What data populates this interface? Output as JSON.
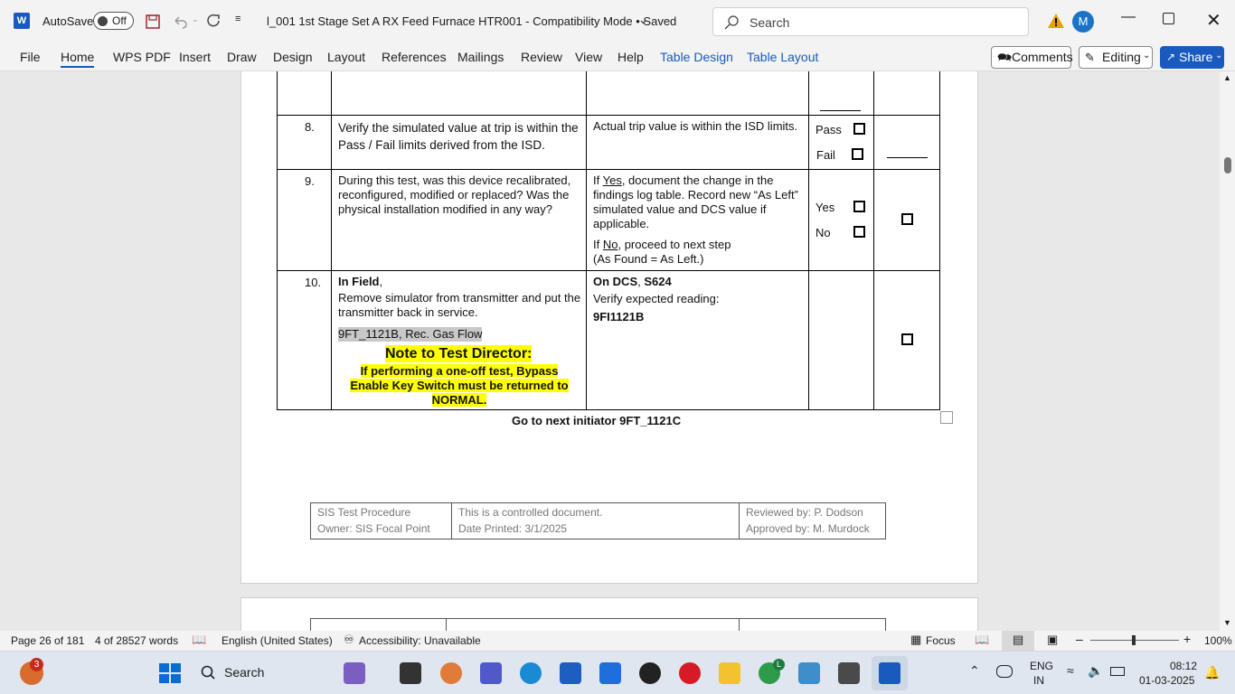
{
  "titlebar": {
    "autosave_label": "AutoSave",
    "autosave_state": "Off",
    "doc_title": "l_001 1st Stage Set A RX Feed Furnace HTR001  -  Compatibility Mode • Saved",
    "search_placeholder": "Search",
    "avatar_initial": "M"
  },
  "ribbon": {
    "tabs": [
      "File",
      "Home",
      "WPS PDF",
      "Insert",
      "Draw",
      "Design",
      "Layout",
      "References",
      "Mailings",
      "Review",
      "View",
      "Help",
      "Table Design",
      "Table Layout"
    ],
    "comments_label": "Comments",
    "editing_label": "Editing",
    "share_label": "Share"
  },
  "rows": [
    {
      "num": "8.",
      "left": "Verify the simulated value at trip is within the Pass / Fail limits derived from the ISD.",
      "right": "Actual trip value is within the ISD limits.",
      "opt1": "Pass",
      "opt2": "Fail"
    },
    {
      "num": "9.",
      "left": "During this test, was this device recalibrated, reconfigured, modified or replaced?  Was the physical installation modified in any way?",
      "right_pre": "If ",
      "right_yes": "Yes",
      "right_rest": ", document the change in the findings log table.  Record new “As Left” simulated value and DCS value if applicable.",
      "right2_pre": "If ",
      "right2_no": "No",
      "right2_rest": ", proceed to next step",
      "right3": "(As Found = As Left.)",
      "opt1": "Yes",
      "opt2": "No"
    },
    {
      "num": "10.",
      "left_bold": "In Field",
      "left_comma": ",",
      "left_text": "Remove simulator from transmitter and put the transmitter back in service.",
      "tag": "9FT_1121B, Rec. Gas Flow",
      "note_title": "Note to Test Director:",
      "note_body": "If performing a one-off test, Bypass Enable Key Switch must be returned to NORMAL.",
      "right_b1": "On DCS",
      "right_b2": ", ",
      "right_b3": "S624",
      "right_text": "Verify expected reading:",
      "right_tag": "9FI1121B"
    }
  ],
  "next_initiator": "Go to next initiator 9FT_1121C",
  "footer": {
    "c1_l1": "SIS Test Procedure",
    "c1_l2": "Owner: SIS Focal Point",
    "c2_l1": "This is a controlled document.",
    "c2_l2": "Date Printed: 3/1/2025",
    "c3_l1": "Reviewed by: P. Dodson",
    "c3_l2": "Approved by: M. Murdock"
  },
  "status": {
    "page": "Page 26 of 181",
    "words": "4 of 28527 words",
    "language": "English (United States)",
    "accessibility": "Accessibility: Unavailable",
    "focus": "Focus",
    "zoom": "100%"
  },
  "taskbar": {
    "search_label": "Search",
    "badge": "3",
    "lang1": "ENG",
    "lang2": "IN",
    "time": "08:12",
    "date": "01-03-2025",
    "chrome_badge": "L"
  }
}
